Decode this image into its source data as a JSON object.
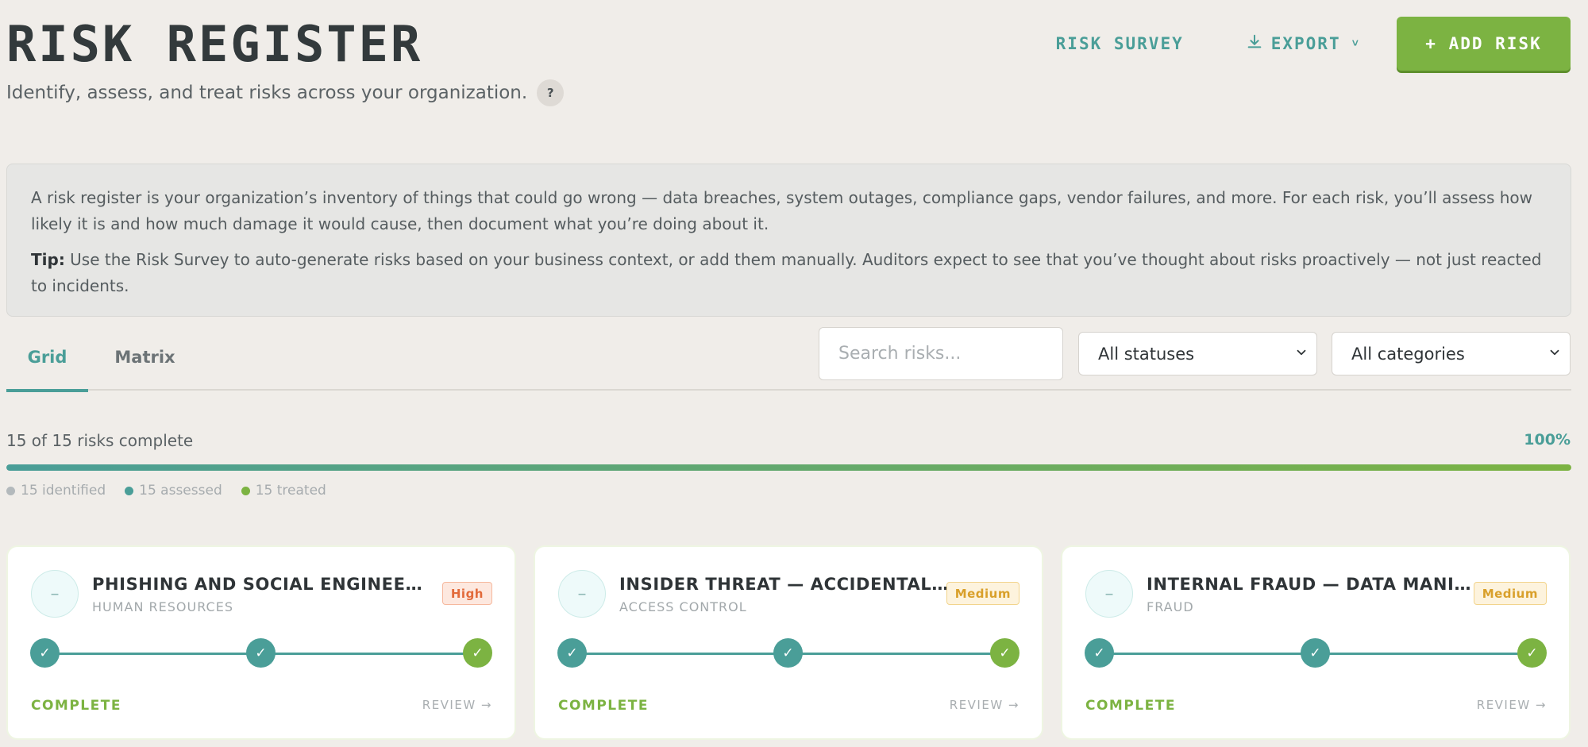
{
  "header": {
    "title": "RISK REGISTER",
    "subtitle": "Identify, assess, and treat risks across your organization.",
    "help": "?",
    "survey_label": "RISK SURVEY",
    "export_label": "EXPORT",
    "export_chevron": "˅",
    "add_label": "+ ADD RISK"
  },
  "info": {
    "text": "A risk register is your organization’s inventory of things that could go wrong — data breaches, system outages, compliance gaps, vendor failures, and more. For each risk, you’ll assess how likely it is and how much damage it would cause, then document what you’re doing about it.",
    "tip_label": "Tip:",
    "tip_text": " Use the Risk Survey to auto-generate risks based on your business context, or add them manually. Auditors expect to see that you’ve thought about risks proactively — not just reacted to incidents."
  },
  "tabs": [
    {
      "label": "Grid",
      "active": true
    },
    {
      "label": "Matrix",
      "active": false
    }
  ],
  "filters": {
    "search_placeholder": "Search risks...",
    "search_value": "",
    "status_value": "All statuses",
    "category_value": "All categories"
  },
  "progress": {
    "label": "15 of 15 risks complete",
    "percent_text": "100%",
    "fraction": 1.0,
    "legend": [
      {
        "label": "15 identified",
        "color": "#b3b9bc"
      },
      {
        "label": "15 assessed",
        "color": "#4a9e98"
      },
      {
        "label": "15 treated",
        "color": "#7cb342"
      }
    ]
  },
  "cards": [
    {
      "icon": "–",
      "title": "PHISHING AND SOCIAL ENGINEERING",
      "category": "HUMAN RESOURCES",
      "badge": "High",
      "status": "COMPLETE",
      "review": "REVIEW →",
      "steps": [
        "✓",
        "✓",
        "✓"
      ]
    },
    {
      "icon": "–",
      "title": "INSIDER THREAT — ACCIDENTAL DATA EXPOSURE",
      "category": "ACCESS CONTROL",
      "badge": "Medium",
      "status": "COMPLETE",
      "review": "REVIEW →",
      "steps": [
        "✓",
        "✓",
        "✓"
      ]
    },
    {
      "icon": "–",
      "title": "INTERNAL FRAUD — DATA MANIPULATION",
      "category": "FRAUD",
      "badge": "Medium",
      "status": "COMPLETE",
      "review": "REVIEW →",
      "steps": [
        "✓",
        "✓",
        "✓"
      ]
    }
  ],
  "colors": {
    "accent_teal": "#4a9e98",
    "accent_green": "#7cb342",
    "badge_high": "#e26a3a",
    "badge_medium": "#d9a02b",
    "background": "#f0ede9"
  }
}
